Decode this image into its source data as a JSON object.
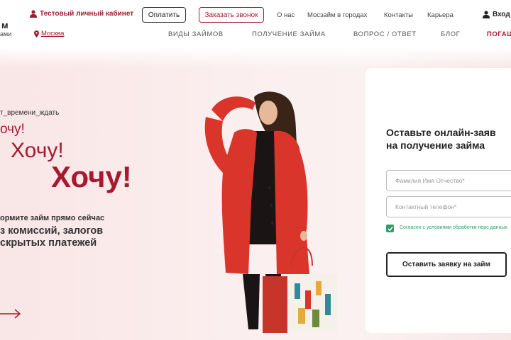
{
  "header": {
    "logo_line1": "м",
    "logo_line2": "ами",
    "cabinet_label": "Тестовый личный кабинет",
    "pay_button": "Оплатить",
    "call_button": "Заказать звонок",
    "top_links": [
      "О нас",
      "Мосзайм в городах",
      "Контакты",
      "Карьера"
    ],
    "login_label": "Вход",
    "city": "Москва",
    "main_nav": [
      "ВИДЫ ЗАЙМОВ",
      "ПОЛУЧЕНИЕ ЗАЙМА",
      "ВОПРОС / ОТВЕТ",
      "БЛОГ",
      "ПОГАШ"
    ],
    "accent_color": "#a6192e"
  },
  "hero": {
    "hashtag": "т_времени_ждать",
    "want_small": "очу!",
    "want_medium": "Хочу!",
    "want_large": "Хочу!",
    "subtitle_1": "ормите займ прямо сейчас",
    "subtitle_2": "з комиссий, залогов",
    "subtitle_3": "скрытых платежей",
    "arrow_icon": "arrow-right-icon",
    "image": "woman-in-red-coat-with-shopping-bags"
  },
  "form": {
    "title": "Оставьте онлайн-заяв\nна получение займа",
    "name_placeholder": "Фамилия Имя Отчество*",
    "phone_placeholder": "Контактный телефон*",
    "consent_checked": true,
    "consent_text": "Согласен с условиями обработки перс данных",
    "submit_label": "Оставить заявку на займ",
    "consent_color": "#2e9e6a"
  }
}
